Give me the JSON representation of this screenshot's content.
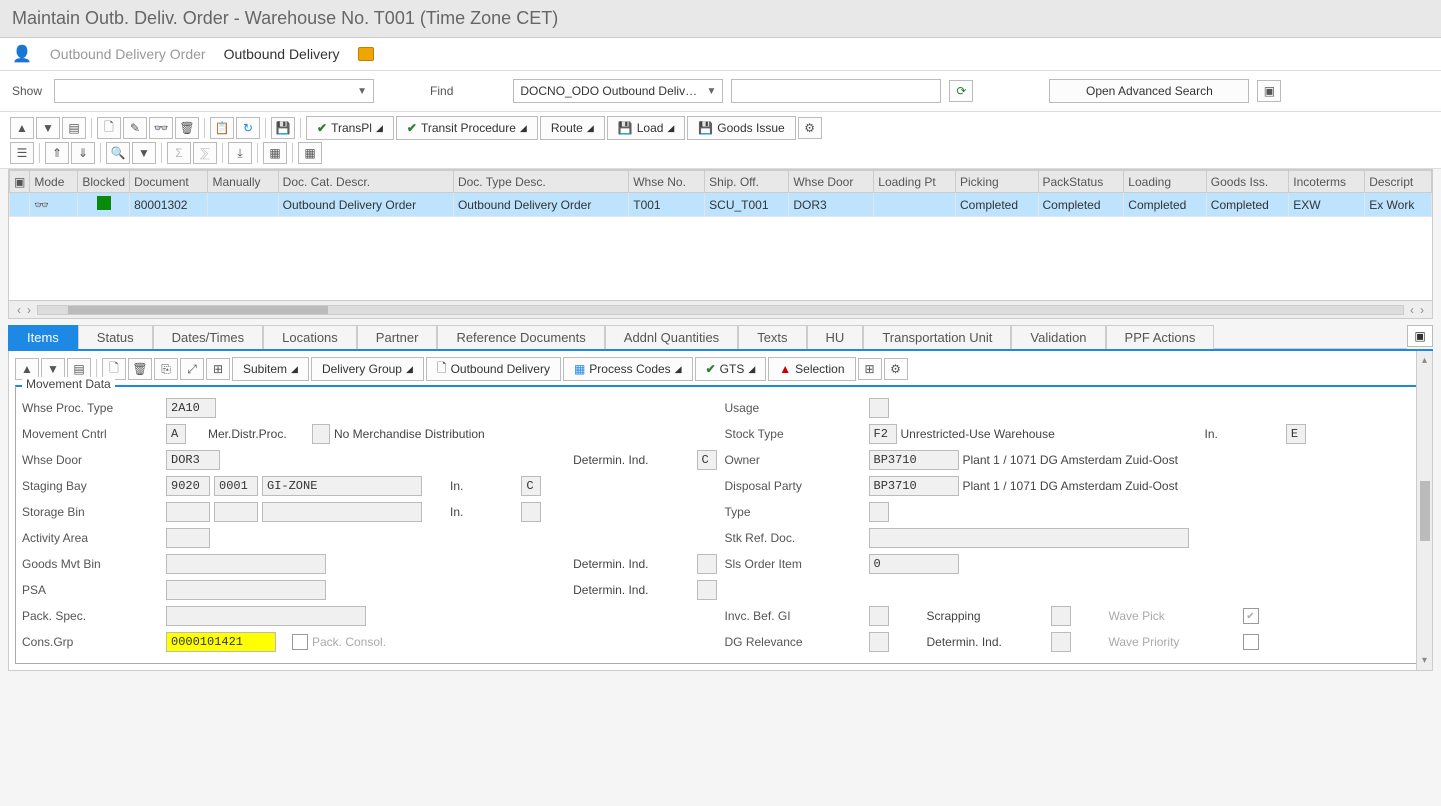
{
  "title": "Maintain Outb. Deliv. Order - Warehouse No. T001 (Time Zone CET)",
  "subheader": {
    "link1": "Outbound Delivery Order",
    "link2": "Outbound Delivery"
  },
  "search": {
    "show_label": "Show",
    "show_value": "",
    "find_label": "Find",
    "find_option": "DOCNO_ODO Outbound Deliv…",
    "find_value": "",
    "open_adv": "Open Advanced Search"
  },
  "toolbar": {
    "transpl": "TransPl",
    "transit": "Transit Procedure",
    "route": "Route",
    "load": "Load",
    "goods_issue": "Goods Issue"
  },
  "grid": {
    "headers": [
      "Mode",
      "Blocked",
      "Document",
      "Manually",
      "Doc. Cat. Descr.",
      "Doc. Type Desc.",
      "Whse No.",
      "Ship. Off.",
      "Whse Door",
      "Loading Pt",
      "Picking",
      "PackStatus",
      "Loading",
      "Goods Iss.",
      "Incoterms",
      "Descript"
    ],
    "row": {
      "mode_icon": "glasses",
      "document": "80001302",
      "manually": "",
      "doc_cat": "Outbound Delivery Order",
      "doc_type": "Outbound Delivery Order",
      "whse_no": "T001",
      "ship_off": "SCU_T001",
      "whse_door": "DOR3",
      "loading_pt": "",
      "picking": "Completed",
      "packstatus": "Completed",
      "loading": "Completed",
      "goods_iss": "Completed",
      "incoterms": "EXW",
      "descript": "Ex Work"
    }
  },
  "tabs": [
    "Items",
    "Status",
    "Dates/Times",
    "Locations",
    "Partner",
    "Reference Documents",
    "Addnl Quantities",
    "Texts",
    "HU",
    "Transportation Unit",
    "Validation",
    "PPF Actions"
  ],
  "detail_toolbar": {
    "subitem": "Subitem",
    "delivery_group": "Delivery Group",
    "outbound_delivery": "Outbound Delivery",
    "process_codes": "Process Codes",
    "gts": "GTS",
    "selection": "Selection"
  },
  "panel": {
    "title": "Movement Data",
    "left": {
      "whse_proc_type": {
        "label": "Whse Proc. Type",
        "v": "2A10"
      },
      "movement_cntrl": {
        "label": "Movement Cntrl",
        "v": "A",
        "mdp_label": "Mer.Distr.Proc.",
        "mdp_text": "No Merchandise Distribution"
      },
      "whse_door": {
        "label": "Whse Door",
        "v": "DOR3",
        "det_label": "Determin. Ind.",
        "det_v": "C"
      },
      "staging_bay": {
        "label": "Staging Bay",
        "v1": "9020",
        "v2": "0001",
        "v3": "GI-ZONE",
        "in_label": "In.",
        "det_v": "C"
      },
      "storage_bin": {
        "label": "Storage Bin",
        "in_label": "In."
      },
      "activity_area": {
        "label": "Activity Area"
      },
      "goods_mvt_bin": {
        "label": "Goods Mvt Bin",
        "det_label": "Determin. Ind."
      },
      "psa": {
        "label": "PSA",
        "det_label": "Determin. Ind."
      },
      "pack_spec": {
        "label": "Pack. Spec."
      },
      "cons_grp": {
        "label": "Cons.Grp",
        "v": "0000101421",
        "pack_consol": "Pack. Consol."
      }
    },
    "right": {
      "usage": {
        "label": "Usage"
      },
      "stock_type": {
        "label": "Stock Type",
        "v": "F2",
        "text": "Unrestricted-Use Warehouse",
        "in_label": "In.",
        "in_v": "E"
      },
      "owner": {
        "label": "Owner",
        "v": "BP3710",
        "text": "Plant 1 / 1071 DG Amsterdam Zuid-Oost"
      },
      "disposal": {
        "label": "Disposal Party",
        "v": "BP3710",
        "text": "Plant 1 / 1071 DG Amsterdam Zuid-Oost"
      },
      "type": {
        "label": "Type"
      },
      "stk_ref": {
        "label": "Stk Ref. Doc."
      },
      "sls_order": {
        "label": "Sls Order Item",
        "v": "0"
      },
      "invc_bef_gi": {
        "label": "Invc. Bef. GI"
      },
      "scrapping": {
        "label": "Scrapping"
      },
      "wave_pick": {
        "label": "Wave Pick"
      },
      "dg_relevance": {
        "label": "DG Relevance"
      },
      "determin_ind": {
        "label": "Determin. Ind."
      },
      "wave_priority": {
        "label": "Wave Priority"
      }
    }
  }
}
